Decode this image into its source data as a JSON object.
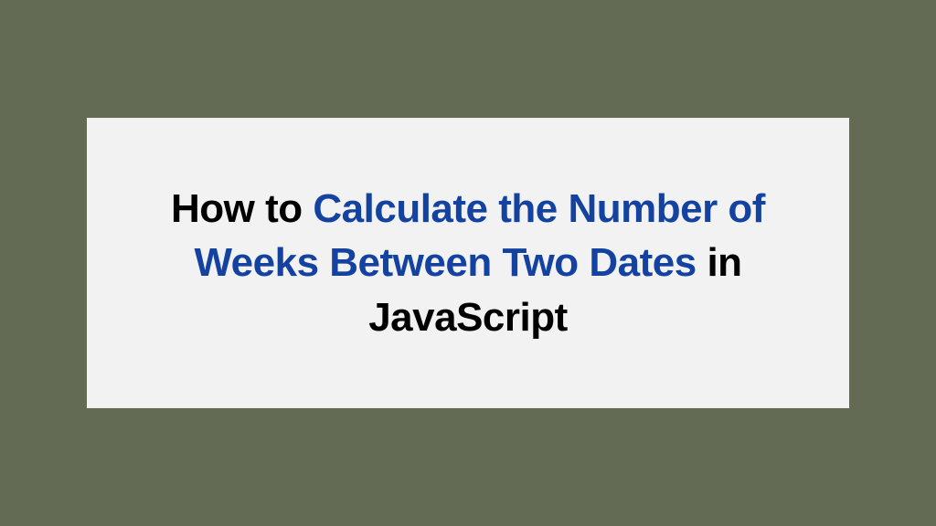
{
  "title": {
    "part1": "How to ",
    "part2": "Calculate the Number of Weeks Between Two Dates",
    "part3": " in JavaScript"
  },
  "colors": {
    "background": "#636b55",
    "card": "#f2f2f2",
    "primary_text": "#000000",
    "highlight_text": "#1342a1"
  }
}
